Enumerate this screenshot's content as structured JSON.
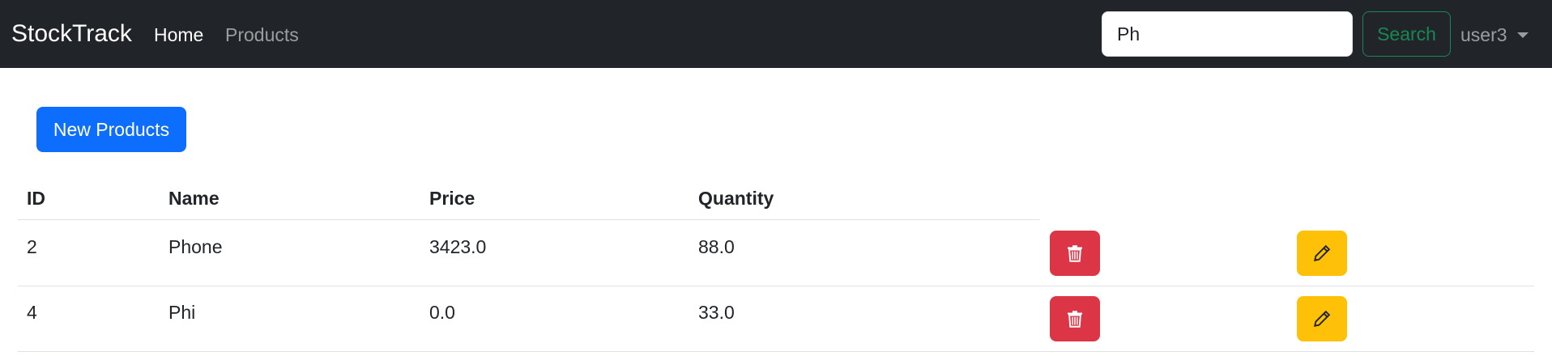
{
  "navbar": {
    "brand": "StockTrack",
    "links": [
      "Home",
      "Products"
    ],
    "search": {
      "value": "Ph",
      "button_label": "Search"
    },
    "user": "user3"
  },
  "main": {
    "new_button_label": "New Products",
    "table": {
      "columns": [
        "ID",
        "Name",
        "Price",
        "Quantity"
      ],
      "rows": [
        {
          "id": "2",
          "name": "Phone",
          "price": "3423.0",
          "quantity": "88.0"
        },
        {
          "id": "4",
          "name": "Phi",
          "price": "0.0",
          "quantity": "33.0"
        }
      ],
      "row_actions": {
        "delete_icon": "trash-icon",
        "edit_icon": "pencil-icon"
      }
    }
  },
  "colors": {
    "navbar_bg": "#212529",
    "primary": "#0d6efd",
    "success": "#198754",
    "danger": "#dc3545",
    "warning": "#ffc107"
  }
}
